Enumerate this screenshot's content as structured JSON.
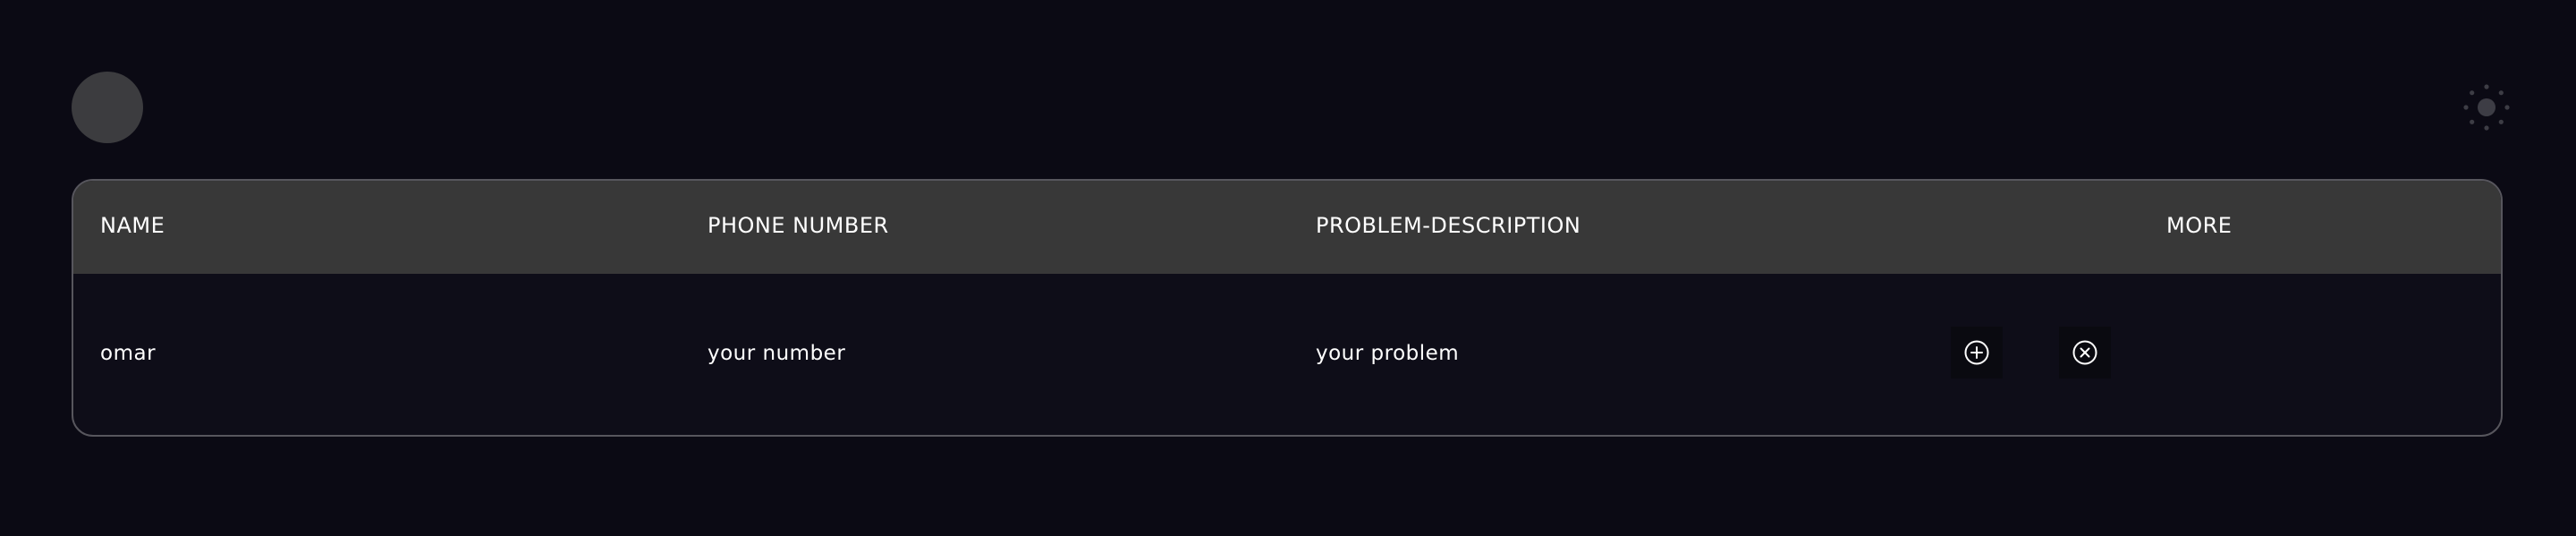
{
  "header": {
    "avatar_icon": "avatar-circle",
    "theme_icon": "sun-icon"
  },
  "table": {
    "columns": [
      "NAME",
      "PHONE NUMBER",
      "PROBLEM-DESCRIPTION",
      "MORE"
    ],
    "rows": [
      {
        "name": "omar",
        "phone": "your number",
        "problem": "your problem",
        "actions": [
          "plus-circle-icon",
          "x-circle-icon"
        ]
      }
    ]
  },
  "colors": {
    "background": "#0b0a14",
    "header_row": "#383838",
    "border": "#57565d",
    "avatar": "#3c3c3f"
  }
}
